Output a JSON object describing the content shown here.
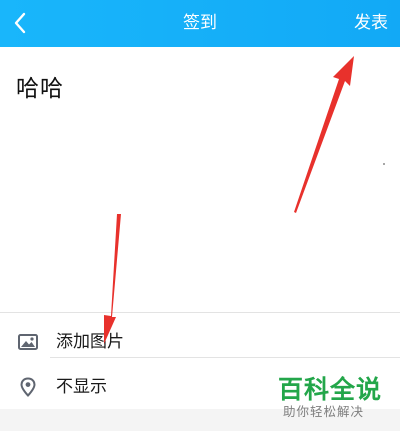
{
  "header": {
    "title": "签到",
    "publish_label": "发表",
    "back_icon": "chevron-left-icon",
    "background_color": "#1ab3fa"
  },
  "post": {
    "text": "哈哈"
  },
  "options": {
    "add_image_label": "添加图片",
    "add_image_icon": "image-icon",
    "location_label": "不显示",
    "location_icon": "location-pin-icon"
  },
  "annotations": {
    "arrow_color": "#e8312c"
  },
  "watermark": {
    "title": "百科全说",
    "subtitle": "助你轻松解决",
    "color": "#23a64a"
  }
}
